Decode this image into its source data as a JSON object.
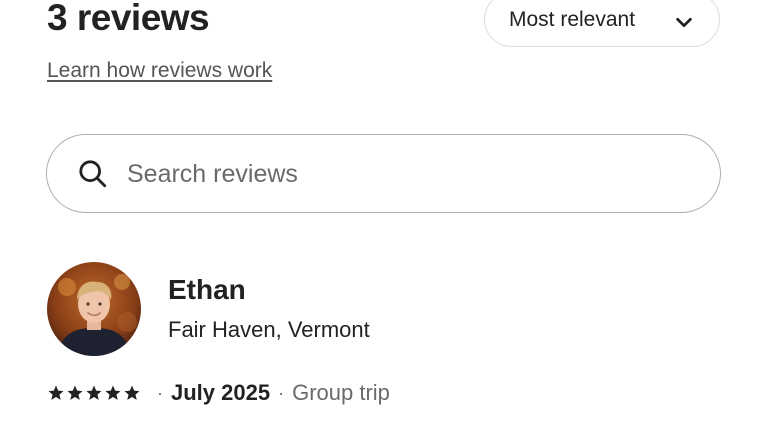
{
  "reviews": {
    "count_title": "3 reviews",
    "sort_label": "Most relevant",
    "learn_link": "Learn how reviews work",
    "search_placeholder": "Search reviews"
  },
  "review": {
    "name": "Ethan",
    "location": "Fair Haven, Vermont",
    "rating": 5,
    "separator": "·",
    "date": "July 2025",
    "trip_type": "Group trip"
  },
  "icons": {
    "sort": "chevron-down-icon",
    "search": "search-icon",
    "star": "star-icon"
  },
  "colors": {
    "text": "#222222",
    "muted": "#6a6a6a",
    "border": "#dddddd"
  }
}
